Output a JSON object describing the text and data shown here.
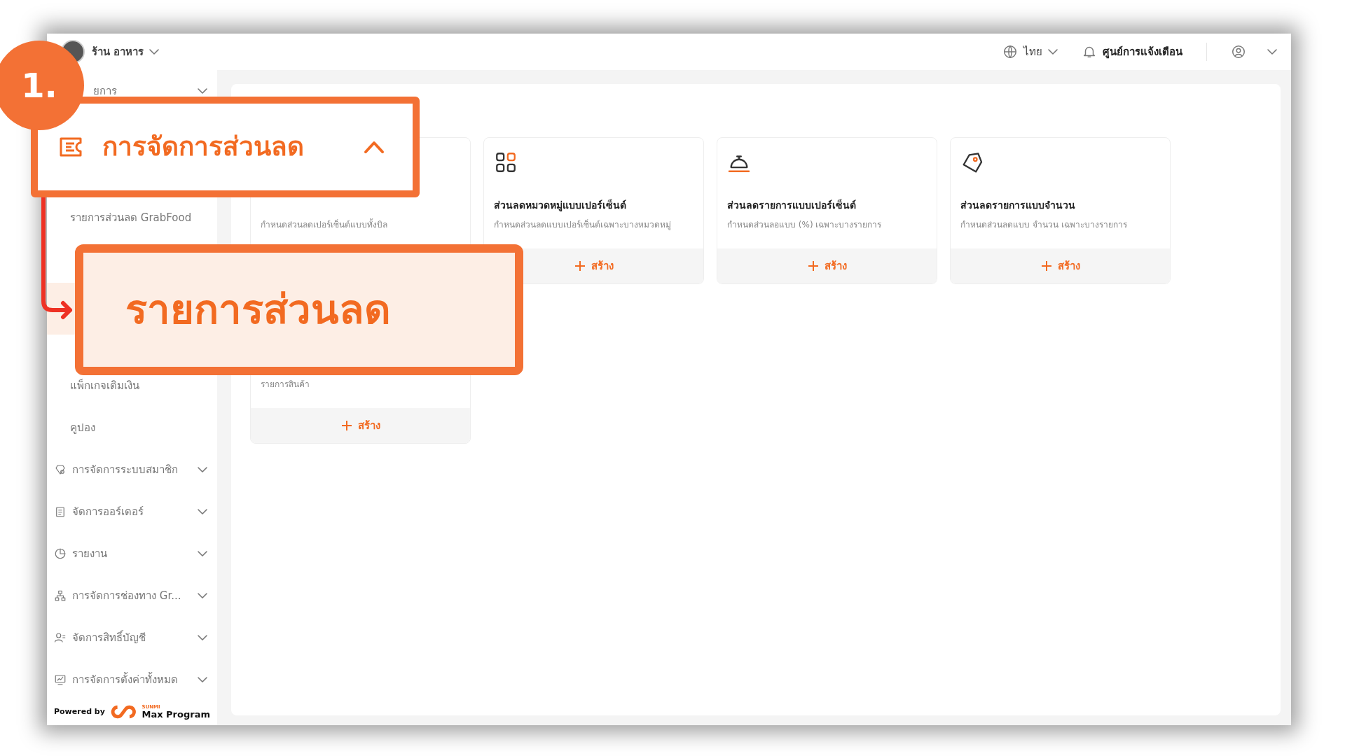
{
  "topbar": {
    "store_name": "ร้าน อาหาร",
    "language": "ไทย",
    "notifications": "ศูนย์การแจ้งเตือน"
  },
  "sidebar": {
    "items": [
      {
        "label": "ยการ",
        "expanded": false
      },
      {
        "children": [
          {
            "label": "รายการส่วนลด GrabFood",
            "selected": false
          },
          {
            "selected": true
          },
          {
            "label": "แพ็กเกจเติมเงิน",
            "selected": false
          },
          {
            "label": "คูปอง",
            "selected": false
          }
        ]
      },
      {
        "label": "การจัดการระบบสมาชิก",
        "expanded": false
      },
      {
        "label": "จัดการออร์เดอร์",
        "expanded": false
      },
      {
        "label": "รายงาน",
        "expanded": false
      },
      {
        "label": "การจัดการช่องทาง Gr...",
        "expanded": false
      },
      {
        "label": "จัดการสิทธิ์บัญชี",
        "expanded": false
      },
      {
        "label": "การจัดการตั้งค่าทั้งหมด",
        "expanded": false
      }
    ],
    "footer": {
      "prefix": "Powered by",
      "brand_small": "SUNMI",
      "brand": "Max Program"
    }
  },
  "cards": [
    {
      "description": "กำหนดส่วนลดเปอร์เซ็นต์แบบทั้งบิล"
    },
    {
      "title": "ส่วนลดหมวดหมู่แบบเปอร์เซ็นต์",
      "description": "กำหนดส่วนลดแบบเปอร์เซ็นต์เฉพาะบางหมวดหมู่",
      "action": "สร้าง"
    },
    {
      "title": "ส่วนลดรายการแบบเปอร์เซ็นต์",
      "description": "กำหนดส่วนลอแบบ (%) เฉพาะบางรายการ",
      "action": "สร้าง"
    },
    {
      "title": "ส่วนลดรายการแบบจำนวน",
      "description": "กำหนดส่วนลดแบบ จำนวน เฉพาะบางรายการ",
      "action": "สร้าง"
    },
    {
      "description": "รายการสินค้า",
      "action": "สร้าง"
    }
  ],
  "tutorial": {
    "step": "1.",
    "menu_callout": {
      "label": "การจัดการส่วนลด",
      "expanded": true
    },
    "item_callout": {
      "label": "รายการส่วนลด"
    }
  }
}
